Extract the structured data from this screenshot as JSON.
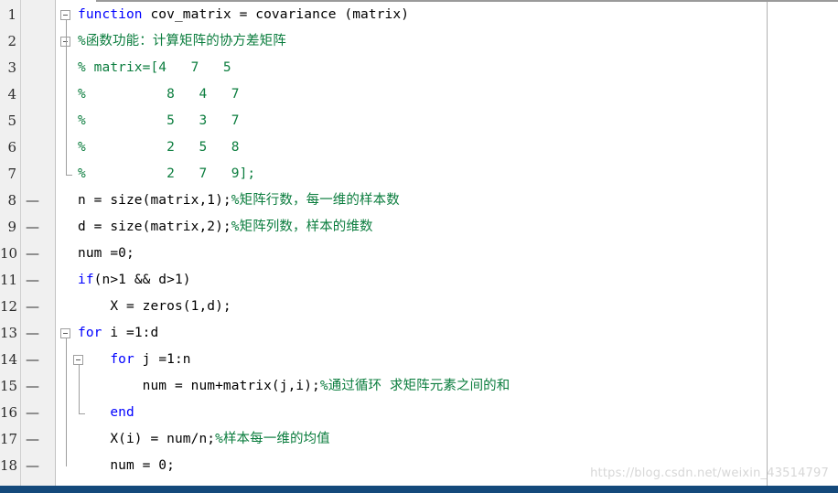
{
  "editor": {
    "language": "MATLAB",
    "file_kind": "function-file",
    "colors": {
      "background": "#ffffff",
      "gutter_background": "#f0f0f0",
      "gutter_separator": "#cfcfcf",
      "keyword": "#0000ff",
      "comment": "#0b7d3e",
      "plain_text": "#000000",
      "fold_marker": "#9e9e9e",
      "column_limit_rule": "#b0b0b0",
      "status_bar": "#14497b",
      "watermark": "#d7d7d7"
    },
    "column_limit_rule_x": 838,
    "execution_dash": "—"
  },
  "watermark": {
    "text": "https://blog.csdn.net/weixin_43514797"
  },
  "lines": [
    {
      "number": "1",
      "dash": "",
      "fold": "open",
      "fold_depth": 0,
      "text": "function cov_matrix = covariance (matrix)",
      "tokens": [
        {
          "t": "function",
          "c": "kw"
        },
        {
          "t": " cov_matrix = covariance (matrix)",
          "c": "plain"
        }
      ]
    },
    {
      "number": "2",
      "dash": "",
      "fold": "open",
      "fold_depth": 0,
      "text": "%函数功能：计算矩阵的协方差矩阵",
      "tokens": [
        {
          "t": "%函数功能：计算矩阵的协方差矩阵",
          "c": "cmt"
        }
      ]
    },
    {
      "number": "3",
      "dash": "",
      "fold": "",
      "fold_depth": 0,
      "text": "% matrix=[4   7   5",
      "tokens": [
        {
          "t": "% matrix=[4   7   5",
          "c": "cmt"
        }
      ]
    },
    {
      "number": "4",
      "dash": "",
      "fold": "",
      "fold_depth": 0,
      "text": "%          8   4   7",
      "tokens": [
        {
          "t": "%          8   4   7",
          "c": "cmt"
        }
      ]
    },
    {
      "number": "5",
      "dash": "",
      "fold": "",
      "fold_depth": 0,
      "text": "%          5   3   7",
      "tokens": [
        {
          "t": "%          5   3   7",
          "c": "cmt"
        }
      ]
    },
    {
      "number": "6",
      "dash": "",
      "fold": "",
      "fold_depth": 0,
      "text": "%          2   5   8",
      "tokens": [
        {
          "t": "%          2   5   8",
          "c": "cmt"
        }
      ]
    },
    {
      "number": "7",
      "dash": "",
      "fold": "end",
      "fold_depth": 0,
      "text": "%          2   7   9];",
      "tokens": [
        {
          "t": "%          2   7   9];",
          "c": "cmt"
        }
      ]
    },
    {
      "number": "8",
      "dash": "—",
      "fold": "",
      "fold_depth": 0,
      "text": "n = size(matrix,1);%矩阵行数，每一维的样本数",
      "tokens": [
        {
          "t": "n = size(matrix,1);",
          "c": "plain"
        },
        {
          "t": "%矩阵行数，每一维的样本数",
          "c": "cmt"
        }
      ]
    },
    {
      "number": "9",
      "dash": "—",
      "fold": "",
      "fold_depth": 0,
      "text": "d = size(matrix,2);%矩阵列数，样本的维数",
      "tokens": [
        {
          "t": "d = size(matrix,2);",
          "c": "plain"
        },
        {
          "t": "%矩阵列数，样本的维数",
          "c": "cmt"
        }
      ]
    },
    {
      "number": "10",
      "dash": "—",
      "fold": "",
      "fold_depth": 0,
      "text": "num =0;",
      "tokens": [
        {
          "t": "num =0;",
          "c": "plain"
        }
      ]
    },
    {
      "number": "11",
      "dash": "—",
      "fold": "",
      "fold_depth": 0,
      "text": "if(n>1 && d>1)",
      "tokens": [
        {
          "t": "if",
          "c": "kw"
        },
        {
          "t": "(n>1 && d>1)",
          "c": "plain"
        }
      ]
    },
    {
      "number": "12",
      "dash": "—",
      "fold": "",
      "fold_depth": 0,
      "text": "    X = zeros(1,d);",
      "tokens": [
        {
          "t": "    X = zeros(1,d);",
          "c": "plain"
        }
      ]
    },
    {
      "number": "13",
      "dash": "—",
      "fold": "open",
      "fold_depth": 0,
      "text": "for i =1:d",
      "tokens": [
        {
          "t": "for",
          "c": "kw"
        },
        {
          "t": " i =1:d",
          "c": "plain"
        }
      ]
    },
    {
      "number": "14",
      "dash": "—",
      "fold": "open",
      "fold_depth": 1,
      "text": "    for j =1:n",
      "tokens": [
        {
          "t": "    ",
          "c": "plain"
        },
        {
          "t": "for",
          "c": "kw"
        },
        {
          "t": " j =1:n",
          "c": "plain"
        }
      ]
    },
    {
      "number": "15",
      "dash": "—",
      "fold": "",
      "fold_depth": 1,
      "text": "        num = num+matrix(j,i);%通过循环 求矩阵元素之间的和",
      "tokens": [
        {
          "t": "        num = num+matrix(j,i);",
          "c": "plain"
        },
        {
          "t": "%通过循环 求矩阵元素之间的和",
          "c": "cmt"
        }
      ]
    },
    {
      "number": "16",
      "dash": "—",
      "fold": "end",
      "fold_depth": 1,
      "text": "    end",
      "tokens": [
        {
          "t": "    ",
          "c": "plain"
        },
        {
          "t": "end",
          "c": "kw"
        }
      ]
    },
    {
      "number": "17",
      "dash": "—",
      "fold": "",
      "fold_depth": 0,
      "text": "    X(i) = num/n;%样本每一维的均值",
      "tokens": [
        {
          "t": "    X(i) = num/n;",
          "c": "plain"
        },
        {
          "t": "%样本每一维的均值",
          "c": "cmt"
        }
      ]
    },
    {
      "number": "18",
      "dash": "—",
      "fold": "",
      "fold_depth": 0,
      "text": "    num = 0;",
      "tokens": [
        {
          "t": "    num = 0;",
          "c": "plain"
        }
      ]
    }
  ]
}
